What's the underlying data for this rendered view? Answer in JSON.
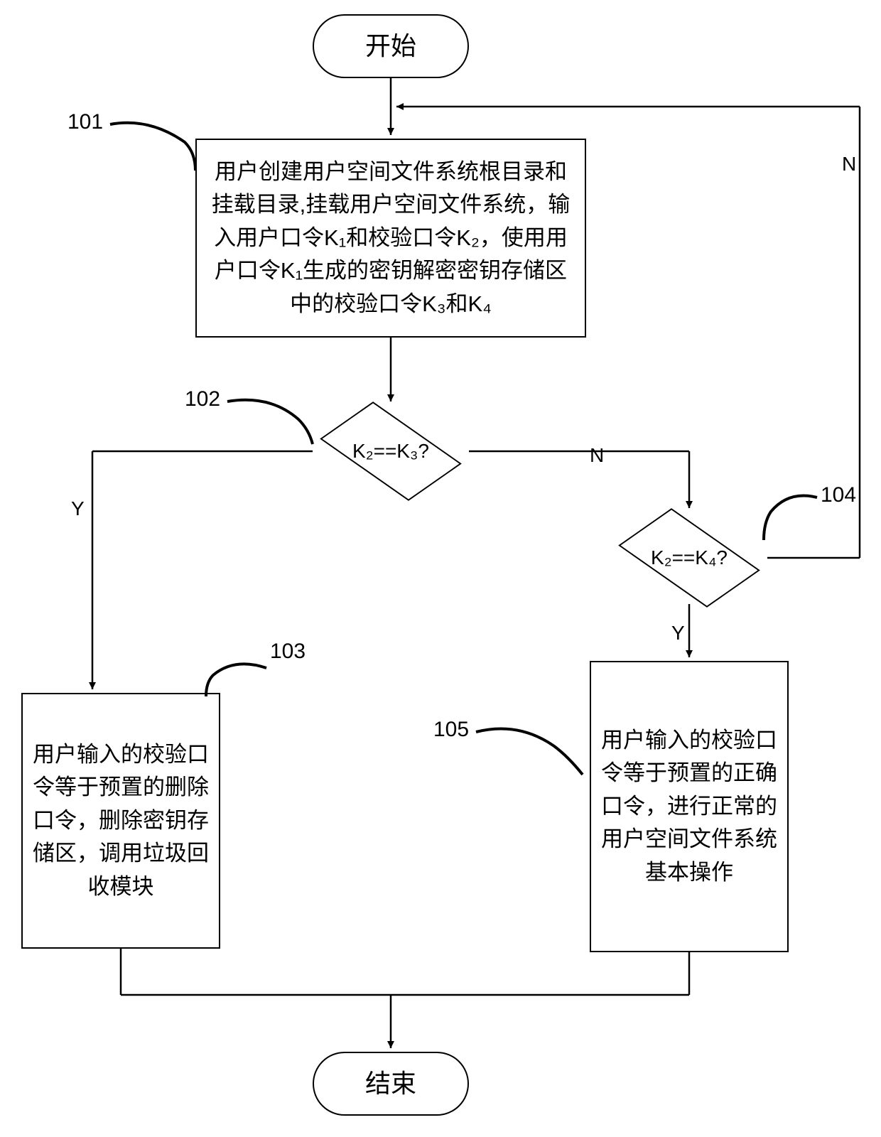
{
  "terminators": {
    "start": "开始",
    "end": "结束"
  },
  "processes": {
    "p101": "用户创建用户空间文件系统根目录和挂载目录,挂载用户空间文件系统，输入用户口令K₁和校验口令K₂，使用用户口令K₁生成的密钥解密密钥存储区中的校验口令K₃和K₄",
    "p103": "用户输入的校验口令等于预置的删除口令，删除密钥存储区，调用垃圾回收模块",
    "p105": "用户输入的校验口令等于预置的正确口令，进行正常的用户空间文件系统基本操作"
  },
  "decisions": {
    "d102": "K₂==K₃?",
    "d104": "K₂==K₄?"
  },
  "step_labels": {
    "s101": "101",
    "s102": "102",
    "s103": "103",
    "s104": "104",
    "s105": "105"
  },
  "edge_labels": {
    "yes": "Y",
    "no": "N"
  }
}
